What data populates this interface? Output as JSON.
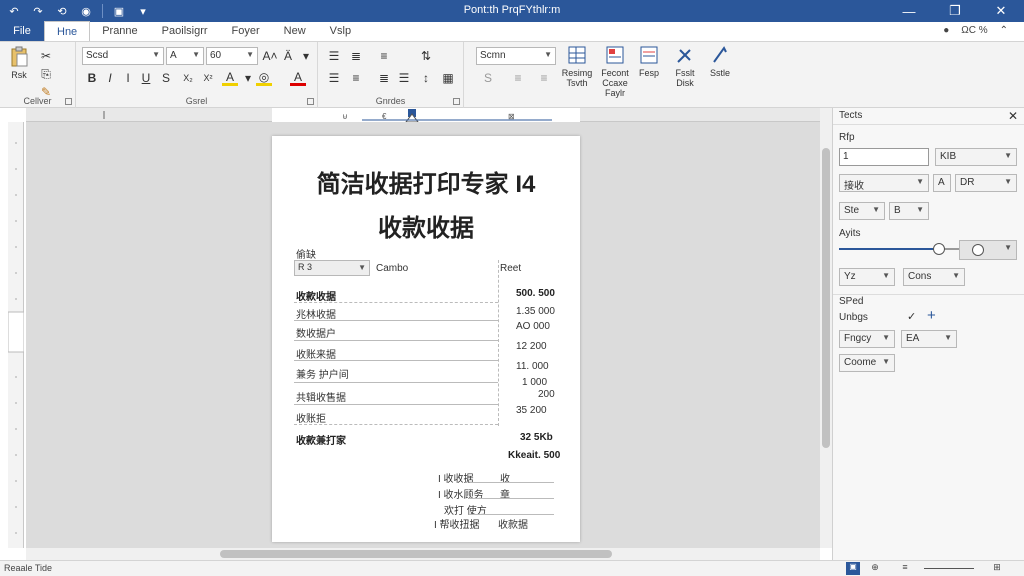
{
  "window": {
    "title": "Pont:th PrqFYthlr:m",
    "min": "—",
    "max": "❐",
    "close": "✕"
  },
  "quick_access": [
    "↶",
    "↷",
    "⟲",
    "◉",
    "💾",
    "▾"
  ],
  "tabs": [
    {
      "label": "File"
    },
    {
      "label": "Hne"
    },
    {
      "label": "Pranne"
    },
    {
      "label": "Paoilsigrr"
    },
    {
      "label": "Foyer"
    },
    {
      "label": "New"
    },
    {
      "label": "Vslp"
    }
  ],
  "tabs_right": {
    "account": "⊖ Ⓒ",
    "share": "ΩC %",
    "collapse": "⌃"
  },
  "ribbon": {
    "clipboard": {
      "label": "Cellver",
      "paste": "Rsk"
    },
    "font": {
      "label": "Gsrel",
      "font_name": "Scsd",
      "font_size": "A",
      "font_size2": "60",
      "grow": "A˄",
      "shrink": "A˅",
      "bold": "B",
      "italic": "I",
      "italic2": "I",
      "underline": "U",
      "strike": "S",
      "sub": "X₂",
      "sup": "X²",
      "highlight": "A",
      "fontcolor": "A"
    },
    "paragraph": {
      "label": "Gnrdes"
    },
    "styles": {
      "style_name": "Scmn"
    },
    "editing": [
      {
        "label": "Resimg\nTsvth"
      },
      {
        "label": "Fecont\nCcaxe\nFaylr"
      },
      {
        "label": "Fesp\n"
      },
      {
        "label": "Fsslt\nDisk"
      },
      {
        "label": "Sstle"
      }
    ]
  },
  "document": {
    "title": "简洁收据打印专家 I4",
    "subtitle": "收款收据",
    "label_date": "偷缺",
    "select_value": "R 3",
    "label_combo": "Cambo",
    "label_rcpt": "Reet",
    "rows": [
      {
        "name": "收款收据",
        "value": "500. 500",
        "bold": true
      },
      {
        "name": "兆林收据",
        "value": "1.35  000",
        "bold": false
      },
      {
        "name": "数收据户",
        "value": "AO  000",
        "bold": false
      },
      {
        "name": "收账来据",
        "value": "12  200",
        "bold": false
      },
      {
        "name": "兼务 护户间",
        "value": "11.  000",
        "bold": false
      },
      {
        "name": "",
        "value": "1  000",
        "bold": false
      },
      {
        "name": "共辑收售据",
        "value": "200",
        "bold": false
      },
      {
        "name": "收账拒",
        "value": "35  200",
        "bold": false
      }
    ],
    "total_label": "收款兼打家",
    "total_value": "32 5Kb",
    "total_value2": "Kkeait. 500",
    "sig": [
      {
        "label": "I 收收据",
        "value": "收"
      },
      {
        "label": "I 收水顾务",
        "value": "章"
      },
      {
        "label": "欢打  使方",
        "value": ""
      },
      {
        "label": "I 帮收扭据",
        "value": "收款据"
      }
    ]
  },
  "pane": {
    "title": "Tects",
    "close": "✕",
    "section1": "Rfp",
    "input1_value": "1",
    "combo1": "KIB",
    "combo2": "接收",
    "btn_a": "A",
    "combo3": "DR",
    "combo4": "Ste",
    "combo5": "B",
    "section2": "Ayits",
    "slider_value": 0.5,
    "combo6": "Yz",
    "combo7": "Cons",
    "section3": "SPed",
    "label_unbs": "Unbgs",
    "check": "✓",
    "plus": "+",
    "combo8": "Fngcy",
    "combo9": "EA",
    "combo10": "Coome"
  },
  "status": {
    "left": "Reaale  Tide",
    "zoom_label": "—"
  }
}
